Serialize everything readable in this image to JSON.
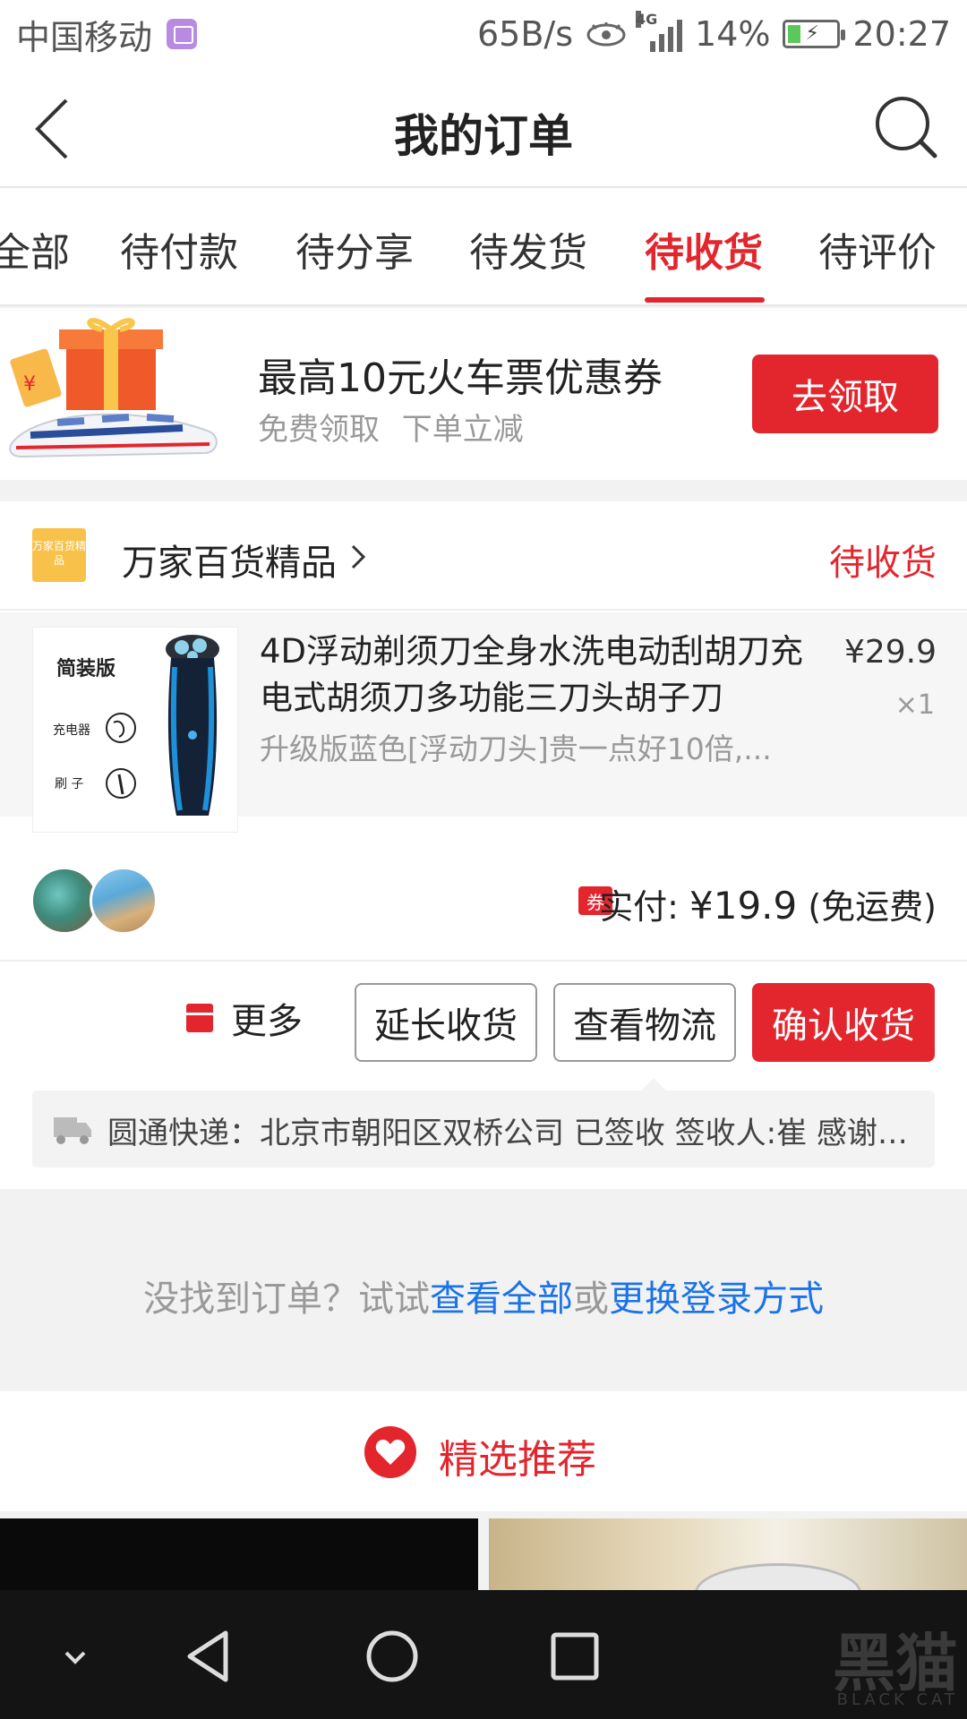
{
  "status_bar": {
    "carrier": "中国移动",
    "speed": "65B/s",
    "network": "4G",
    "battery": "14%",
    "time": "20:27"
  },
  "header": {
    "title": "我的订单",
    "back_icon": "back-arrow-icon",
    "search_icon": "search-icon"
  },
  "tabs": [
    {
      "label": "全部"
    },
    {
      "label": "待付款"
    },
    {
      "label": "待分享"
    },
    {
      "label": "待发货"
    },
    {
      "label": "待收货",
      "active": true
    },
    {
      "label": "待评价"
    }
  ],
  "banner": {
    "title": "最高10元火车票优惠券",
    "subtitle": "免费领取  下单立减",
    "button": "去领取"
  },
  "order": {
    "shop_logo_text": "万家百货精品",
    "shop_name": "万家百货精品",
    "status": "待收货",
    "product": {
      "title": "4D浮动剃须刀全身水洗电动刮胡刀充电式胡须刀多功能三刀头胡子刀",
      "variant": "升级版蓝色[浮动刀头]贵一点好10倍,...",
      "price": "¥29.9",
      "qty": "×1",
      "image_labels": {
        "pack": "简装版",
        "charger": "充电器",
        "brush": "刷 子"
      }
    },
    "payment": {
      "coupon_tag": "券",
      "label": "实付: ",
      "amount": "¥19.9",
      "note": " (免运费)"
    },
    "actions": {
      "more": "更多",
      "extend": "延长收货",
      "logistics": "查看物流",
      "confirm": "确认收货"
    },
    "logistics_text": "圆通快递：北京市朝阳区双桥公司 已签收  签收人:崔 感谢使用圆通速递，期待再次为您服务"
  },
  "hint": {
    "prefix": "没找到订单？试试",
    "link1": "查看全部",
    "middle": "或",
    "link2": "更换登录方式"
  },
  "recommend": {
    "title": "精选推荐"
  },
  "watermark": {
    "main": "黑猫",
    "sub": "BLACK CAT"
  },
  "colors": {
    "accent": "#e3262e",
    "link": "#1a73e8"
  }
}
